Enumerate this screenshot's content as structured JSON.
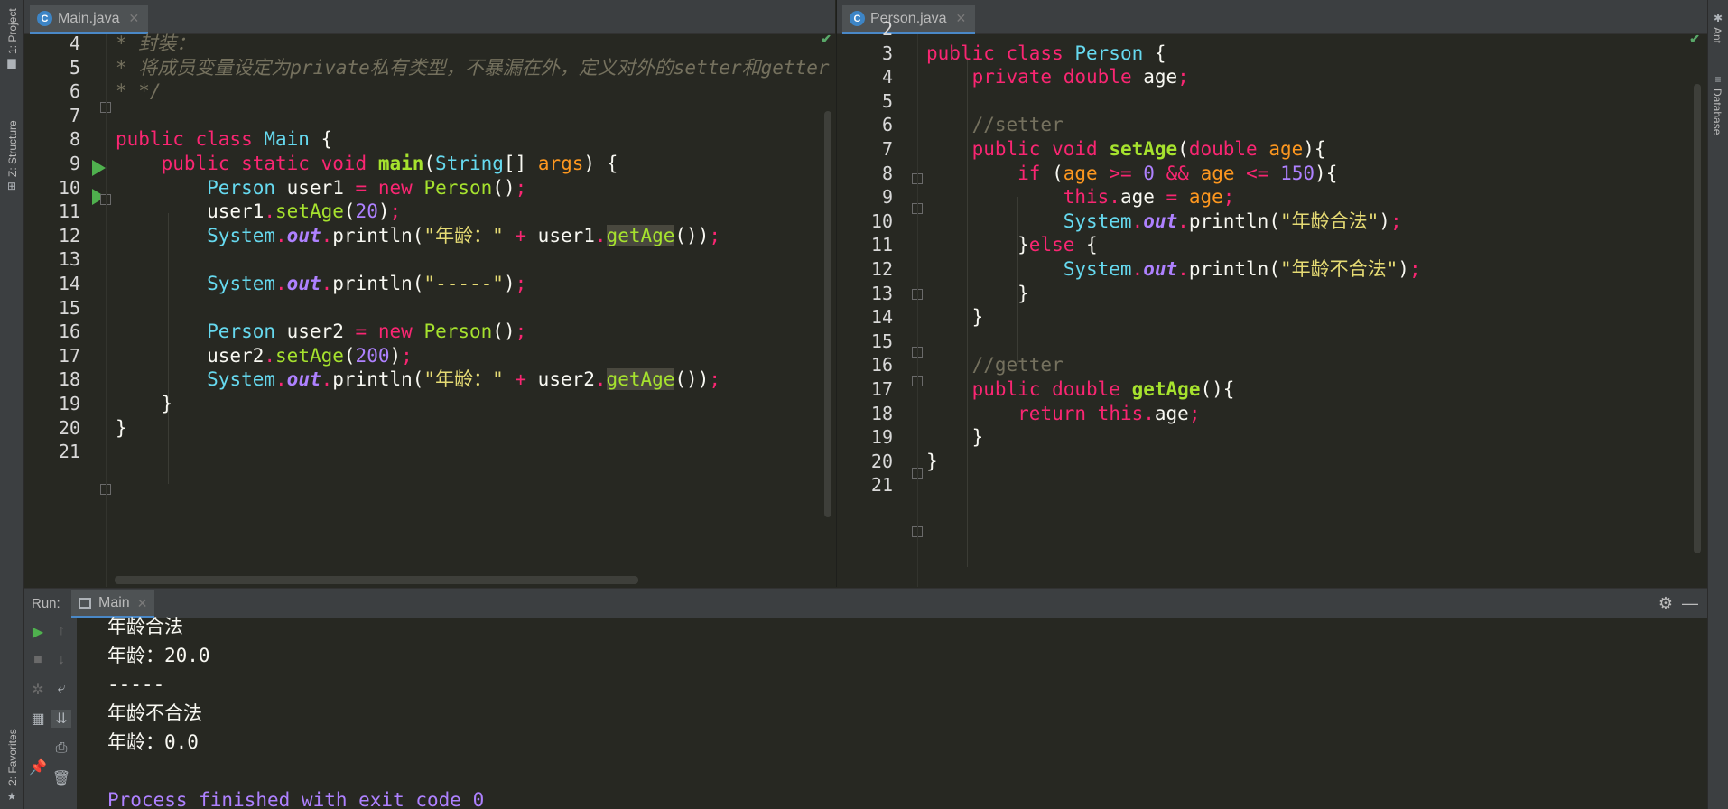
{
  "left_strip": {
    "project": "1: Project",
    "structure": "Z: Structure",
    "favorites": "2: Favorites"
  },
  "right_strip": {
    "ant": "Ant",
    "database": "Database"
  },
  "left_editor": {
    "tab": {
      "icon_letter": "C",
      "label": "Main.java"
    },
    "lines": [
      {
        "n": "4",
        "html": "<span class=\"cmi\">* 封装：</span>"
      },
      {
        "n": "5",
        "html": "<span class=\"cmi\">* 将成员变量设定为private私有类型，不暴漏在外，定义对外的setter和getter</span>"
      },
      {
        "n": "6",
        "html": "<span class=\"cmi\">* */</span>"
      },
      {
        "n": "7",
        "html": ""
      },
      {
        "n": "8",
        "html": "<span class=\"kw\">public class</span> <span class=\"cls\">Main</span> {"
      },
      {
        "n": "9",
        "html": "    <span class=\"kw\">public static void</span> <span class=\"fnb\">main</span>(<span class=\"cls\">String</span>[] <span class=\"par\">args</span>) {"
      },
      {
        "n": "10",
        "html": "        <span class=\"cls\">Person</span> user1 <span class=\"kw\">=</span> <span class=\"kw\">new</span> <span class=\"fn\">Person</span>()<span class=\"kw\">;</span>"
      },
      {
        "n": "11",
        "html": "        user1<span class=\"kw\">.</span><span class=\"fn\">setAge</span>(<span class=\"num\">20</span>)<span class=\"kw\">;</span>"
      },
      {
        "n": "12",
        "html": "        <span class=\"cls\">System</span><span class=\"kw\">.</span><span class=\"out\">out</span><span class=\"kw\">.</span>println(<span class=\"str\">\"年龄：\"</span> <span class=\"kw\">+</span> user1<span class=\"kw\">.</span><span class=\"fn hl\">getAge</span>())<span class=\"kw\">;</span>"
      },
      {
        "n": "13",
        "html": ""
      },
      {
        "n": "14",
        "html": "        <span class=\"cls\">System</span><span class=\"kw\">.</span><span class=\"out\">out</span><span class=\"kw\">.</span>println(<span class=\"str\">\"-----\"</span>)<span class=\"kw\">;</span>"
      },
      {
        "n": "15",
        "html": ""
      },
      {
        "n": "16",
        "html": "        <span class=\"cls\">Person</span> user2 <span class=\"kw\">=</span> <span class=\"kw\">new</span> <span class=\"fn\">Person</span>()<span class=\"kw\">;</span>"
      },
      {
        "n": "17",
        "html": "        user2<span class=\"kw\">.</span><span class=\"fn\">setAge</span>(<span class=\"num\">200</span>)<span class=\"kw\">;</span>"
      },
      {
        "n": "18",
        "html": "        <span class=\"cls\">System</span><span class=\"kw\">.</span><span class=\"out\">out</span><span class=\"kw\">.</span>println(<span class=\"str\">\"年龄：\"</span> <span class=\"kw\">+</span> user2<span class=\"kw\">.</span><span class=\"fn hl\">getAge</span>())<span class=\"kw\">;</span>"
      },
      {
        "n": "19",
        "html": "    }"
      },
      {
        "n": "20",
        "html": "}"
      },
      {
        "n": "21",
        "html": ""
      }
    ]
  },
  "right_editor": {
    "tab": {
      "icon_letter": "C",
      "label": "Person.java"
    },
    "lines": [
      {
        "n": "2",
        "html": ""
      },
      {
        "n": "3",
        "html": "<span class=\"kw\">public class</span> <span class=\"cls\">Person</span> {"
      },
      {
        "n": "4",
        "html": "    <span class=\"kw\">private double</span> age<span class=\"kw\">;</span>"
      },
      {
        "n": "5",
        "html": ""
      },
      {
        "n": "6",
        "html": "    <span class=\"cm\">//setter</span>"
      },
      {
        "n": "7",
        "html": "    <span class=\"kw\">public void</span> <span class=\"fnb\">setAge</span>(<span class=\"kw\">double</span> <span class=\"par\">age</span>){"
      },
      {
        "n": "8",
        "html": "        <span class=\"kw\">if</span> (<span class=\"par\">age</span> <span class=\"kw\">&gt;=</span> <span class=\"num\">0</span> <span class=\"kw\">&amp;&amp;</span> <span class=\"par\">age</span> <span class=\"kw\">&lt;=</span> <span class=\"num\">150</span>){"
      },
      {
        "n": "9",
        "html": "            <span class=\"kw\">this.</span>age <span class=\"kw\">=</span> <span class=\"par\">age</span><span class=\"kw\">;</span>"
      },
      {
        "n": "10",
        "html": "            <span class=\"cls\">System</span><span class=\"kw\">.</span><span class=\"out\">out</span><span class=\"kw\">.</span>println(<span class=\"str\">\"年龄合法\"</span>)<span class=\"kw\">;</span>"
      },
      {
        "n": "11",
        "html": "        }<span class=\"kw\">else</span> {"
      },
      {
        "n": "12",
        "html": "            <span class=\"cls\">System</span><span class=\"kw\">.</span><span class=\"out\">out</span><span class=\"kw\">.</span>println(<span class=\"str\">\"年龄不合法\"</span>)<span class=\"kw\">;</span>"
      },
      {
        "n": "13",
        "html": "        }"
      },
      {
        "n": "14",
        "html": "    }"
      },
      {
        "n": "15",
        "html": ""
      },
      {
        "n": "16",
        "html": "    <span class=\"cm\">//getter</span>"
      },
      {
        "n": "17",
        "html": "    <span class=\"kw\">public double</span> <span class=\"fnb\">getAge</span>(){"
      },
      {
        "n": "18",
        "html": "        <span class=\"kw\">return</span> <span class=\"kw\">this.</span>age<span class=\"kw\">;</span>"
      },
      {
        "n": "19",
        "html": "    }"
      },
      {
        "n": "20",
        "html": "}"
      },
      {
        "n": "21",
        "html": ""
      }
    ]
  },
  "run_panel": {
    "label": "Run:",
    "tab": "Main",
    "output": [
      "年龄合法",
      "年龄：20.0",
      "-----",
      "年龄不合法",
      "年龄：0.0",
      "",
      "Process finished with exit code 0"
    ]
  },
  "colors": {
    "keyword": "#f92672",
    "class": "#66d9ef",
    "function": "#a6e22e",
    "number": "#ae81ff",
    "string": "#e6db74",
    "comment": "#75715e",
    "param": "#fd971f"
  }
}
